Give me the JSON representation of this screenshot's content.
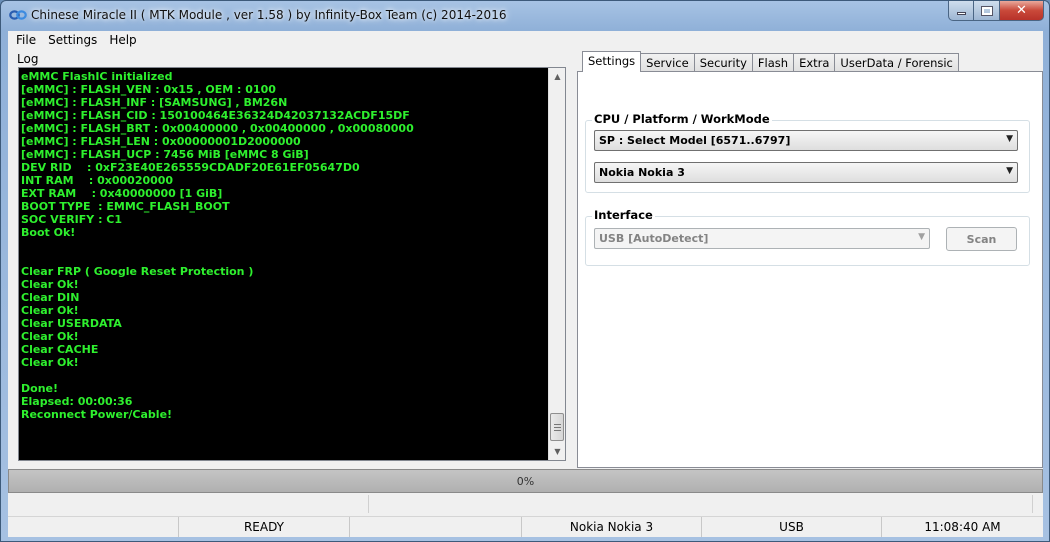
{
  "window": {
    "title": "Chinese Miracle II ( MTK Module , ver 1.58 ) by Infinity-Box Team (c) 2014-2016",
    "close_glyph": "✕"
  },
  "menu": [
    "File",
    "Settings",
    "Help"
  ],
  "log": {
    "label": "Log",
    "lines": [
      "eMMC FlashIC initialized",
      "[eMMC] : FLASH_VEN : 0x15 , OEM : 0100",
      "[eMMC] : FLASH_INF : [SAMSUNG] , BM26N",
      "[eMMC] : FLASH_CID : 150100464E36324D42037132ACDF15DF",
      "[eMMC] : FLASH_BRT : 0x00400000 , 0x00400000 , 0x00080000",
      "[eMMC] : FLASH_LEN : 0x00000001D2000000",
      "[eMMC] : FLASH_UCP : 7456 MiB [eMMC 8 GiB]",
      "DEV RID    : 0xF23E40E265559CDADF20E61EF05647D0",
      "INT RAM    : 0x00020000",
      "EXT RAM    : 0x40000000 [1 GiB]",
      "BOOT TYPE  : EMMC_FLASH_BOOT",
      "SOC VERIFY : C1",
      "Boot Ok!",
      "",
      "",
      "Clear FRP ( Google Reset Protection )",
      "Clear Ok!",
      "Clear DIN",
      "Clear Ok!",
      "Clear USERDATA",
      "Clear Ok!",
      "Clear CACHE",
      "Clear Ok!",
      "",
      "Done!",
      "Elapsed: 00:00:36",
      "Reconnect Power/Cable!"
    ],
    "text_color": "#2ef02e"
  },
  "tabs": [
    "Settings",
    "Service",
    "Security",
    "Flash",
    "Extra",
    "UserData / Forensic"
  ],
  "active_tab": 0,
  "settings": {
    "cpu_group_title": "CPU / Platform / WorkMode",
    "platform_selected": "SP : Select Model [6571..6797]",
    "model_selected": "Nokia Nokia 3",
    "interface_group_title": "Interface",
    "interface_selected": "USB [AutoDetect]",
    "scan_label": "Scan"
  },
  "progress": {
    "value": 0,
    "text": "0%",
    "fill_color": "#37d137"
  },
  "status": {
    "state": "READY",
    "model": "Nokia Nokia 3",
    "interface": "USB",
    "time": "11:08:40 AM"
  },
  "icons": {
    "app": "infinity-logo-icon",
    "dropdown": "chevron-down-icon"
  }
}
